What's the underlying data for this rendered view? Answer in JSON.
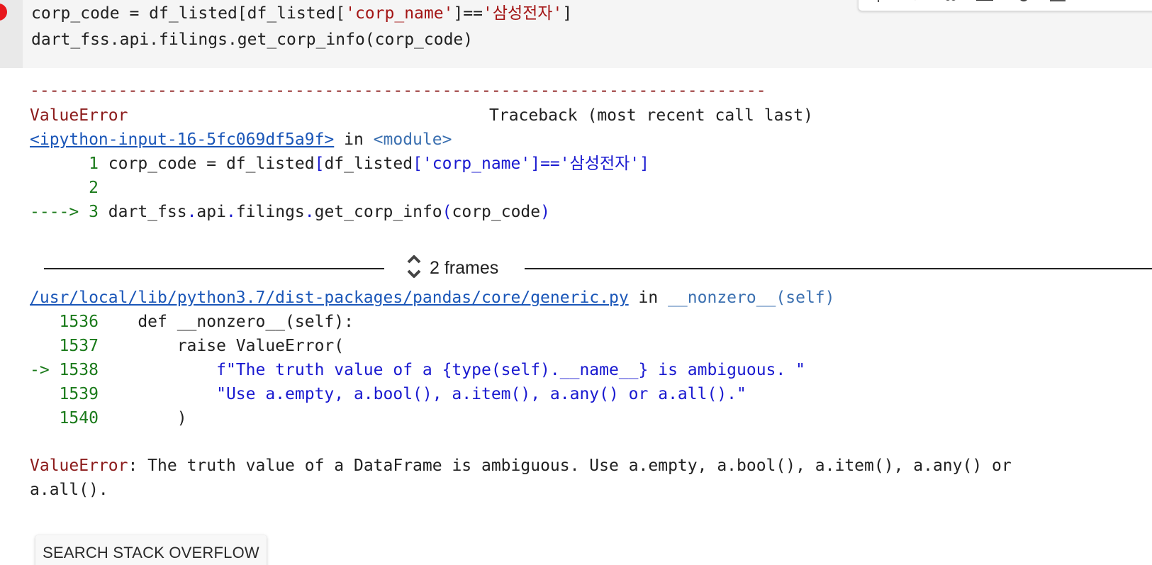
{
  "code_cell": {
    "line1_prefix": "corp_code = df_listed[df_listed[",
    "line1_str1": "'corp_name'",
    "line1_mid": "]==",
    "line1_str2": "'삼성전자'",
    "line1_end": "]",
    "line2": "dart_fss.api.filings.get_corp_info(corp_code)"
  },
  "traceback": {
    "dashes": "---------------------------------------------------------------------------",
    "error_type": "ValueError",
    "header_right": "Traceback (most recent call last)",
    "input_link": "<ipython-input-16-5fc069df5a9f>",
    "in_word": " in ",
    "module": "<module>",
    "frame1_lines": [
      {
        "marker": "      1 ",
        "code_a": "corp_code = df_listed",
        "code_b": "[",
        "code_c": "df_listed",
        "code_d": "['corp_name']==",
        "code_e": "'삼성전자'",
        "code_f": "]"
      },
      {
        "marker": "      2",
        "code": ""
      },
      {
        "marker": "----> 3 ",
        "code_a": "dart_fss",
        "code_b": ".",
        "code_c": "api",
        "code_d": ".",
        "code_e": "filings",
        "code_f": ".",
        "code_g": "get_corp_info",
        "code_h": "(",
        "code_i": "corp_code",
        "code_j": ")"
      }
    ],
    "frames_label": "2 frames",
    "file_link": "/usr/local/lib/python3.7/dist-packages/pandas/core/generic.py",
    "func": "__nonzero__(self)",
    "frame2_lines": [
      {
        "marker": "   1536",
        "code": "    def __nonzero__(self):"
      },
      {
        "marker": "   1537",
        "code": "        raise ValueError("
      },
      {
        "marker": "-> 1538",
        "code": "            f\"The truth value of a {type(self).__name__} is ambiguous. \""
      },
      {
        "marker": "   1539",
        "code": "            \"Use a.empty, a.bool(), a.item(), a.any() or a.all().\""
      },
      {
        "marker": "   1540",
        "code": "        )"
      }
    ],
    "final_error_type": "ValueError",
    "final_message": ": The truth value of a DataFrame is ambiguous. Use a.empty, a.bool(), a.item(), a.any() or",
    "final_message_cont": "a.all()."
  },
  "search_button_label": "SEARCH STACK OVERFLOW",
  "colors": {
    "run_dot": "#e8171c",
    "error_red": "#8b1a1a",
    "link_blue": "#1a56b8",
    "code_blue": "#1919d0",
    "marker_green": "#1a7a1a"
  },
  "icons": [
    "arrow-up-icon",
    "arrow-down-icon",
    "link-icon",
    "comment-icon",
    "settings-icon",
    "mirror-cell-icon",
    "delete-icon",
    "more-icon",
    "chevron-up-down-icon"
  ]
}
